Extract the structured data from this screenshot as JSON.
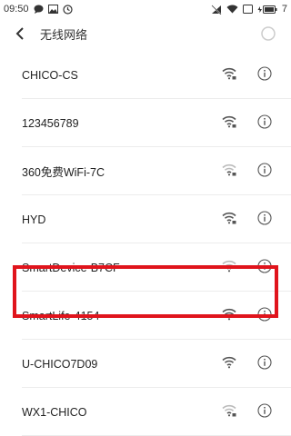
{
  "status_bar": {
    "time": "09:50",
    "battery_text": "7",
    "left_icons": [
      "chat-bubble-icon",
      "image-icon",
      "alarm-icon"
    ],
    "right_icons": [
      "no-signal-icon",
      "wifi-icon",
      "sim-icon",
      "battery-charging-icon"
    ]
  },
  "header": {
    "title": "无线网络",
    "back_icon": "chevron-left-icon",
    "refresh_icon": "refresh-spinner-icon"
  },
  "networks": [
    {
      "ssid": "CHICO-CS",
      "signal": "strong-locked"
    },
    {
      "ssid": "123456789",
      "signal": "strong-locked"
    },
    {
      "ssid": "360免费WiFi-7C",
      "signal": "weak-locked"
    },
    {
      "ssid": "HYD",
      "signal": "strong-locked"
    },
    {
      "ssid": "SmartDevice-B7CF",
      "signal": "weak-open"
    },
    {
      "ssid": "SmartLife-4154",
      "signal": "strong-open"
    },
    {
      "ssid": "U-CHICO7D09",
      "signal": "strong-open"
    },
    {
      "ssid": "WX1-CHICO",
      "signal": "weak-locked"
    }
  ],
  "highlighted_network": "SmartLife-4154",
  "colors": {
    "highlight": "#e0141c",
    "text": "#222222",
    "icon": "#555555",
    "icon_faded": "#bbbbbb"
  }
}
